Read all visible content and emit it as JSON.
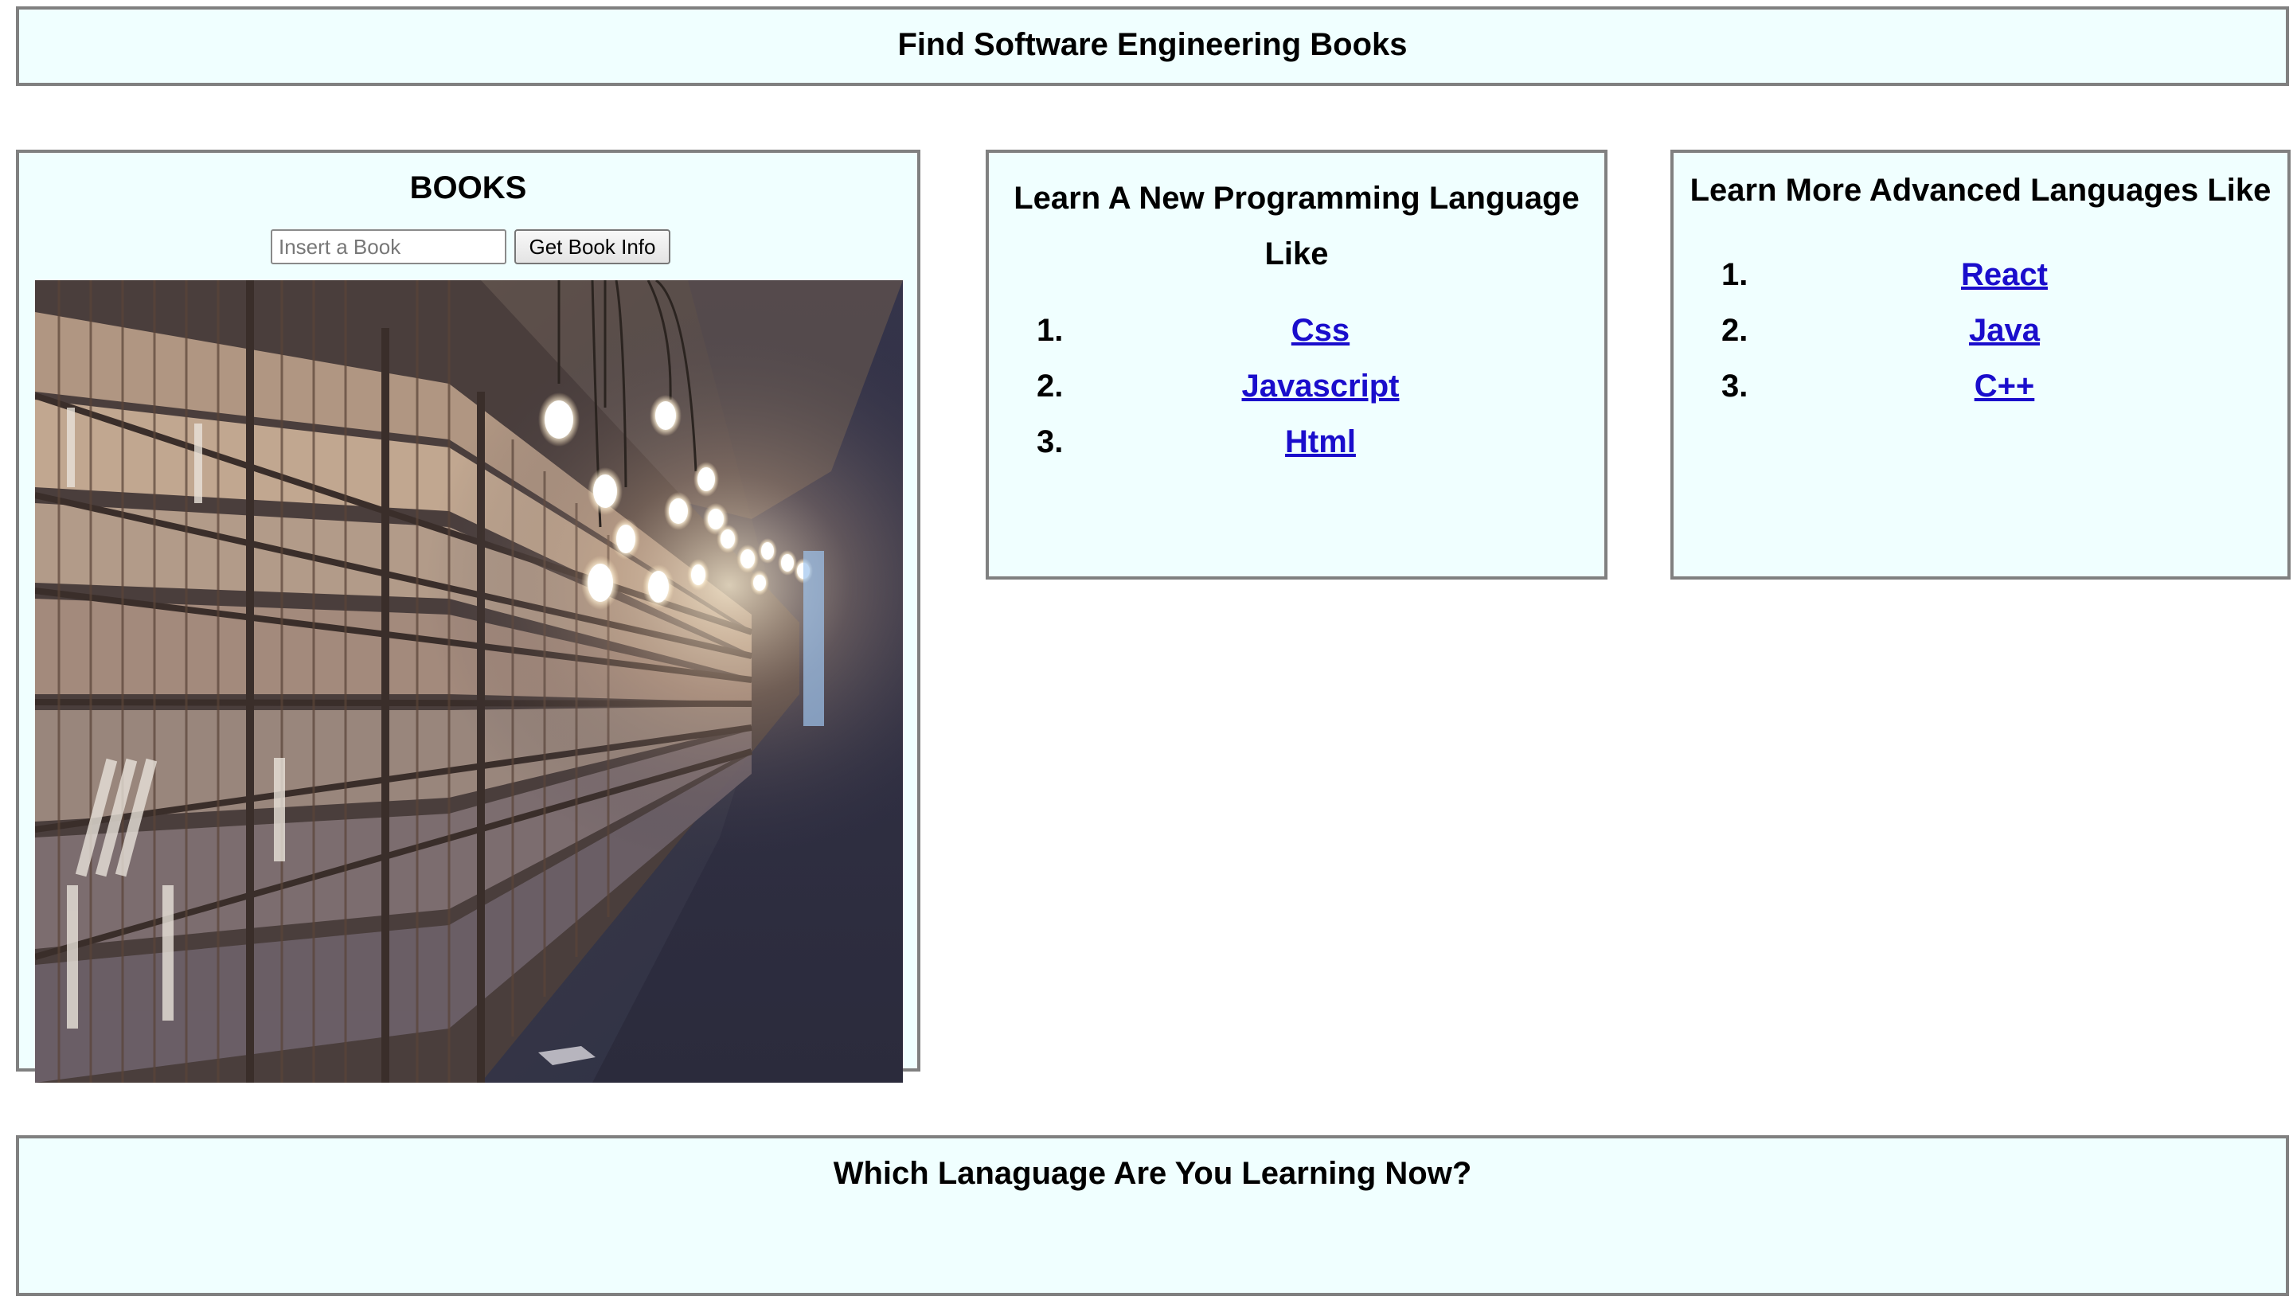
{
  "header": {
    "title": "Find Software Engineering Books"
  },
  "books": {
    "title": "BOOKS",
    "search_placeholder": "Insert a Book",
    "search_value": "",
    "button_label": "Get Book Info",
    "image": "library-bookshelves-with-hanging-bulbs"
  },
  "languages": {
    "title": "Learn A New Programming Language Like",
    "items": [
      {
        "number": "1.",
        "label": "Css"
      },
      {
        "number": "2.",
        "label": "Javascript"
      },
      {
        "number": "3.",
        "label": "Html"
      }
    ]
  },
  "advanced": {
    "title": "Learn More Advanced Languages Like",
    "items": [
      {
        "number": "1.",
        "label": "React"
      },
      {
        "number": "2.",
        "label": "Java"
      },
      {
        "number": "3.",
        "label": "C++"
      }
    ]
  },
  "footer": {
    "title": "Which Lanaguage Are You Learning Now?"
  },
  "colors": {
    "panel_bg": "#f0ffff",
    "panel_border": "#808080",
    "link": "#1a0dcc"
  }
}
